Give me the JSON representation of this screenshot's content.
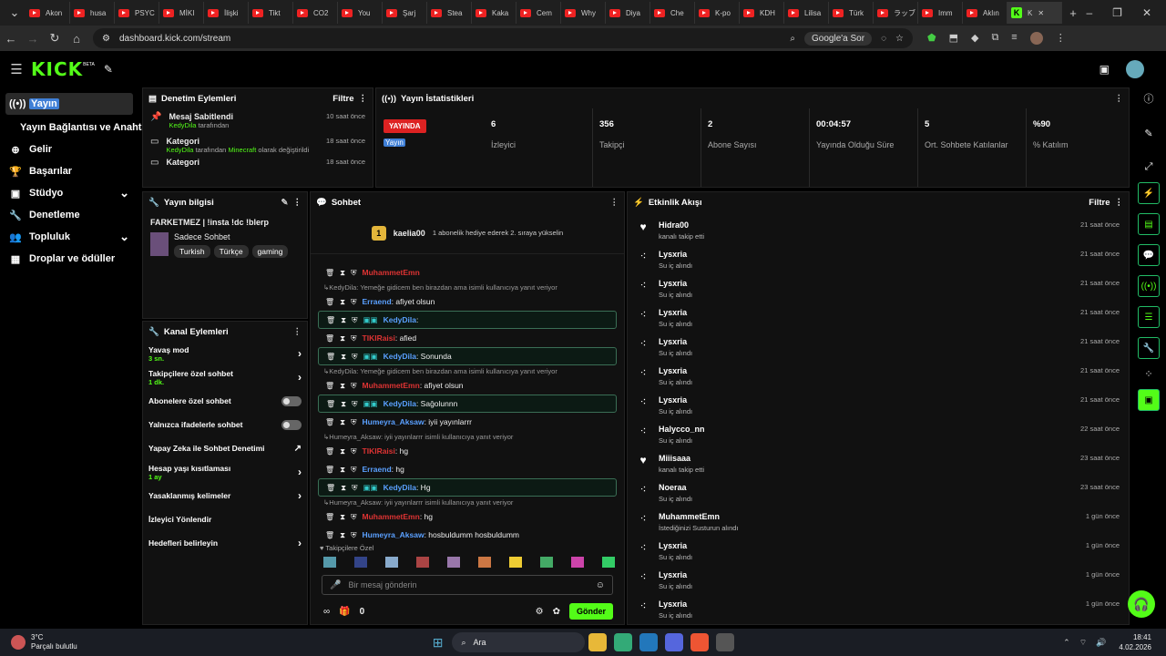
{
  "tabs": [
    {
      "label": "Akon"
    },
    {
      "label": "husa"
    },
    {
      "label": "PSYC"
    },
    {
      "label": "MİKI"
    },
    {
      "label": "İlişki"
    },
    {
      "label": "Tikt"
    },
    {
      "label": "CO2"
    },
    {
      "label": "You"
    },
    {
      "label": "Şarj"
    },
    {
      "label": "Stea"
    },
    {
      "label": "Kaka"
    },
    {
      "label": "Cem"
    },
    {
      "label": "Why"
    },
    {
      "label": "Diya"
    },
    {
      "label": "Che"
    },
    {
      "label": "K-po"
    },
    {
      "label": "KDH"
    },
    {
      "label": "Lilisa"
    },
    {
      "label": "Türk"
    },
    {
      "label": "ラッブ"
    },
    {
      "label": "Imm"
    },
    {
      "label": "Aklın"
    }
  ],
  "active_tab": {
    "label": "K"
  },
  "url": "dashboard.kick.com/stream",
  "google_search": "Google'a Sor",
  "logo": "KICK",
  "logo_beta": "BETA",
  "nav": [
    {
      "label": "Yayın",
      "icon": "broadcast-icon"
    },
    {
      "label": "Yayın Bağlantısı ve Anahtar",
      "icon": ""
    },
    {
      "label": "Gelir",
      "icon": "money-icon"
    },
    {
      "label": "Başarılar",
      "icon": "trophy-icon"
    },
    {
      "label": "Stüdyo",
      "icon": "studio-icon"
    },
    {
      "label": "Denetleme",
      "icon": "wrench-icon"
    },
    {
      "label": "Topluluk",
      "icon": "community-icon"
    },
    {
      "label": "Droplar ve ödüller",
      "icon": "drops-icon"
    }
  ],
  "moderation": {
    "title": "Denetim Eylemleri",
    "filter": "Filtre",
    "items": [
      {
        "title": "Mesaj Sabitlendi",
        "by": "KedyDila",
        "detail": "tarafından",
        "time": "10 saat önce"
      },
      {
        "title": "Kategori",
        "by": "KedyDila",
        "detail": "tarafından",
        "category": "Minecraft",
        "detail2": "olarak değiştirildi",
        "time": "18 saat önce"
      },
      {
        "title": "Kategori",
        "time": "18 saat önce"
      }
    ]
  },
  "stats": {
    "live_badge": "YAYINDA",
    "live_sub": "Yayın",
    "items": [
      {
        "value": "6",
        "label": "İzleyici"
      },
      {
        "value": "356",
        "label": "Takipçi"
      },
      {
        "value": "2",
        "label": "Abone Sayısı"
      },
      {
        "value": "00:04:57",
        "label": "Yayında Olduğu Süre"
      },
      {
        "value": "5",
        "label": "Ort. Sohbete Katılanlar"
      },
      {
        "value": "%90",
        "label": "% Katılım"
      }
    ],
    "title": "Yayın İstatistikleri"
  },
  "stream_info": {
    "title": "Yayın bilgisi",
    "stream_title": "FARKETMEZ | !insta !dc !blerp",
    "category": "Sadece Sohbet",
    "tags": [
      "Turkish",
      "Türkçe",
      "gaming"
    ]
  },
  "channel_actions": {
    "title": "Kanal Eylemleri",
    "items": [
      {
        "label": "Yavaş mod",
        "value": "3 sn.",
        "control": "chevron"
      },
      {
        "label": "Takipçilere özel sohbet",
        "value": "1 dk.",
        "control": "chevron"
      },
      {
        "label": "Abonelere özel sohbet",
        "value": "",
        "control": "toggle"
      },
      {
        "label": "Yalnızca ifadelerle sohbet",
        "value": "",
        "control": "toggle"
      },
      {
        "label": "Yapay Zeka ile Sohbet Denetimi",
        "value": "",
        "control": "external"
      },
      {
        "label": "Hesap yaşı kısıtlaması",
        "value": "1 ay",
        "control": "chevron"
      },
      {
        "label": "Yasaklanmış kelimeler",
        "value": "",
        "control": "chevron"
      },
      {
        "label": "İzleyici Yönlendir",
        "value": "",
        "control": "none"
      },
      {
        "label": "Hedefleri belirleyin",
        "value": "",
        "control": "chevron"
      }
    ]
  },
  "chat": {
    "title": "Sohbet",
    "pinned": {
      "user": "kaelia00",
      "text": "1 abonelik hediye ederek 2. sıraya yükselin",
      "rank": "1"
    },
    "messages": [
      {
        "type": "msg",
        "user": "MuhammetEmn",
        "color": "red",
        "text": "",
        "box": false
      },
      {
        "type": "reply",
        "text": "KedyDila: Yemeğe gidicem ben birazdan ama isimli kullanıcıya yanıt veriyor"
      },
      {
        "type": "msg",
        "user": "Erraend",
        "color": "blu",
        "text": ": afiyet olsun",
        "box": false
      },
      {
        "type": "msg",
        "user": "KedyDila",
        "color": "blu",
        "text": ":",
        "box": true
      },
      {
        "type": "msg",
        "user": "TIKIRaisi",
        "color": "red",
        "text": ": afied",
        "box": false
      },
      {
        "type": "msg",
        "user": "KedyDila",
        "color": "blu",
        "text": ": Sonunda",
        "box": true
      },
      {
        "type": "reply",
        "text": "KedyDila: Yemeğe gidicem ben birazdan ama isimli kullanıcıya yanıt veriyor"
      },
      {
        "type": "msg",
        "user": "MuhammetEmn",
        "color": "red",
        "text": ": afiyet olsun",
        "box": false
      },
      {
        "type": "msg",
        "user": "KedyDila",
        "color": "blu",
        "text": ": Sağolunnn",
        "box": true
      },
      {
        "type": "msg",
        "user": "Humeyra_Aksaw",
        "color": "blu",
        "text": ": iyii yayınlarrr",
        "box": false
      },
      {
        "type": "reply",
        "text": "Humeyra_Aksaw: iyii yayınlarrr isimli kullanıcıya yanıt veriyor"
      },
      {
        "type": "msg",
        "user": "TIKIRaisi",
        "color": "red",
        "text": ": hg",
        "box": false
      },
      {
        "type": "msg",
        "user": "Erraend",
        "color": "blu",
        "text": ": hg",
        "box": false
      },
      {
        "type": "msg",
        "user": "KedyDila",
        "color": "blu",
        "text": ": Hg",
        "box": true
      },
      {
        "type": "reply",
        "text": "Humeyra_Aksaw: iyii yayınlarrr isimli kullanıcıya yanıt veriyor"
      },
      {
        "type": "msg",
        "user": "MuhammetEmn",
        "color": "red",
        "text": ": hg",
        "box": false
      },
      {
        "type": "msg",
        "user": "Humeyra_Aksaw",
        "color": "blu",
        "text": ": hosbuldumm hosbuldumm",
        "box": false
      }
    ],
    "followers_label": "Takipçilere Özel",
    "placeholder": "Bir mesaj gönderin",
    "count": "0",
    "send": "Gönder"
  },
  "events": {
    "title": "Etkinlik Akışı",
    "filter": "Filtre",
    "items": [
      {
        "icon": "heart",
        "name": "Hidra00",
        "desc": "kanalı takip etti",
        "time": "21 saat önce"
      },
      {
        "icon": "dots",
        "name": "Lysxria",
        "desc": "Su iç alındı",
        "time": "21 saat önce"
      },
      {
        "icon": "dots",
        "name": "Lysxria",
        "desc": "Su iç alındı",
        "time": "21 saat önce"
      },
      {
        "icon": "dots",
        "name": "Lysxria",
        "desc": "Su iç alındı",
        "time": "21 saat önce"
      },
      {
        "icon": "dots",
        "name": "Lysxria",
        "desc": "Su iç alındı",
        "time": "21 saat önce"
      },
      {
        "icon": "dots",
        "name": "Lysxria",
        "desc": "Su iç alındı",
        "time": "21 saat önce"
      },
      {
        "icon": "dots",
        "name": "Lysxria",
        "desc": "Su iç alındı",
        "time": "21 saat önce"
      },
      {
        "icon": "dots",
        "name": "Halycco_nn",
        "desc": "Su iç alındı",
        "time": "22 saat önce"
      },
      {
        "icon": "heart",
        "name": "Miiisaaa",
        "desc": "kanalı takip etti",
        "time": "23 saat önce"
      },
      {
        "icon": "dots",
        "name": "Noeraa",
        "desc": "Su iç alındı",
        "time": "23 saat önce"
      },
      {
        "icon": "dots",
        "name": "MuhammetEmn",
        "desc": "İstediğinizi Susturun alındı",
        "time": "1 gün önce"
      },
      {
        "icon": "dots",
        "name": "Lysxria",
        "desc": "Su iç alındı",
        "time": "1 gün önce"
      },
      {
        "icon": "dots",
        "name": "Lysxria",
        "desc": "Su iç alındı",
        "time": "1 gün önce"
      },
      {
        "icon": "dots",
        "name": "Lysxria",
        "desc": "Su iç alındı",
        "time": "1 gün önce"
      }
    ]
  },
  "taskbar": {
    "weather_temp": "3°C",
    "weather_desc": "Parçalı bulutlu",
    "search": "Ara",
    "time": "18:41",
    "date": "4.02.2026"
  }
}
